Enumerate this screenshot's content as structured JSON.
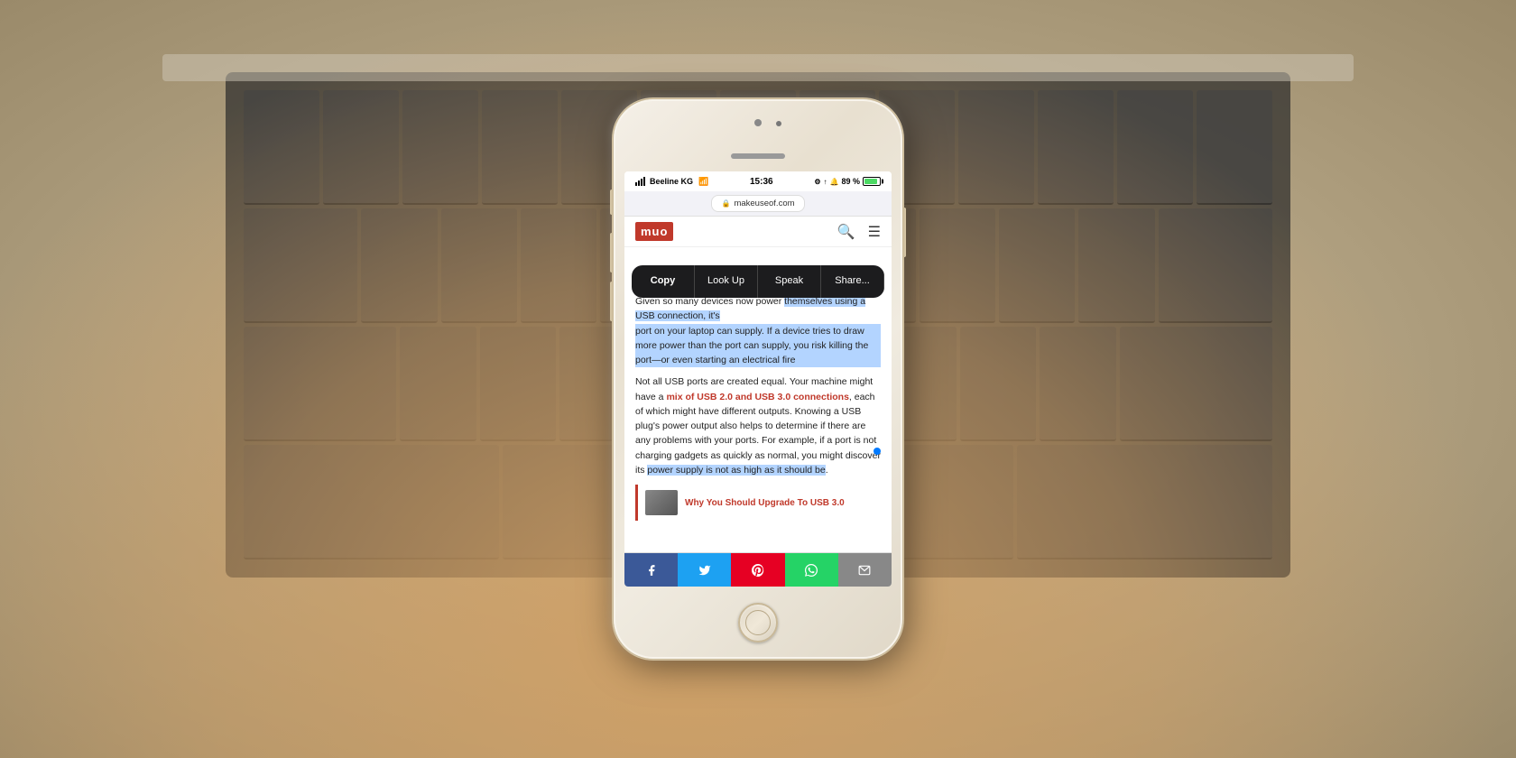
{
  "background": {
    "color": "#c8b89a"
  },
  "phone": {
    "statusBar": {
      "carrier": "Beeline KG",
      "time": "15:36",
      "battery": "89 %",
      "batteryColor": "#4cd964"
    },
    "addressBar": {
      "url": "makeuseof.com",
      "secure": true
    },
    "navbar": {
      "logo": "muo",
      "searchIcon": "🔍",
      "menuIcon": "☰"
    },
    "article": {
      "textBefore": "Given so many devices now power themselves using a USB connection, it's",
      "highlightedText": "themselves using a USB connection, it's",
      "paragraphMiddle": "port on your laptop can supply. If a device tries to draw more power than the port can supply, you risk killing the port—or even starting an electrical fire",
      "paragraphFull": "Not all USB ports are created equal. Your machine might have a ",
      "linkText": "mix of USB 2.0 and USB 3.0 connections",
      "paragraphAfterLink": ", each of which might have different outputs. Knowing a USB plug's power output also helps to determine if there are any problems with your ports. For example, if a port is not charging gadgets as quickly as normal, you might discover its power supply is not as high as it should be.",
      "powerSupplyText": "power supply not as high as",
      "shouldBeText": "should be"
    },
    "contextMenu": {
      "copy": "Copy",
      "lookUp": "Look Up",
      "speak": "Speak",
      "share": "Share..."
    },
    "related": {
      "title": "Why You Should Upgrade To USB 3.0",
      "accentColor": "#c0392b"
    },
    "shareBar": {
      "facebook": "f",
      "twitter": "t",
      "pinterest": "p",
      "whatsapp": "w",
      "email": "@"
    }
  }
}
